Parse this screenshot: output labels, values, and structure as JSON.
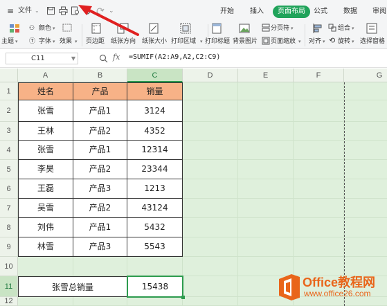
{
  "menubar": {
    "file_label": "文件",
    "tabs": [
      {
        "label": "开始",
        "active": false
      },
      {
        "label": "插入",
        "active": false
      },
      {
        "label": "页面布局",
        "active": true
      },
      {
        "label": "公式",
        "active": false
      },
      {
        "label": "数据",
        "active": false
      },
      {
        "label": "审阅",
        "active": false
      }
    ]
  },
  "ribbon": {
    "theme": "主题",
    "colors": "颜色",
    "fonts": "字体",
    "effects": "效果",
    "margins": "页边距",
    "orientation": "纸张方向",
    "size": "纸张大小",
    "print_area": "打印区域",
    "print_titles": "打印标题",
    "background": "背景图片",
    "page_break": "分页符",
    "page_zoom": "页面缩放",
    "align": "对齐",
    "group": "组合",
    "rotate": "旋转",
    "selection_pane": "选择窗格"
  },
  "formula_bar": {
    "name_box": "C11",
    "fx": "fx",
    "formula": "=SUMIF(A2:A9,A2,C2:C9)"
  },
  "grid": {
    "columns": [
      "A",
      "B",
      "C",
      "D",
      "E",
      "F",
      "G"
    ],
    "rows": [
      "1",
      "2",
      "3",
      "4",
      "5",
      "6",
      "7",
      "8",
      "9",
      "10",
      "11",
      "12"
    ],
    "header": [
      "姓名",
      "产品",
      "销量"
    ],
    "data": [
      [
        "张雪",
        "产品1",
        "3124"
      ],
      [
        "王林",
        "产品2",
        "4352"
      ],
      [
        "张雪",
        "产品1",
        "12314"
      ],
      [
        "李昊",
        "产品2",
        "23344"
      ],
      [
        "王磊",
        "产品3",
        "1213"
      ],
      [
        "吴雪",
        "产品2",
        "43124"
      ],
      [
        "刘伟",
        "产品1",
        "5432"
      ],
      [
        "林雪",
        "产品3",
        "5543"
      ]
    ],
    "summary_label": "张雪总销量",
    "summary_value": "15438",
    "selected_cell": "C11"
  },
  "watermark": {
    "brand": "Office教程网",
    "url": "www.office26.com"
  },
  "colors": {
    "accent": "#20a35a",
    "header_fill": "#f7b287",
    "sheet_bg": "#dff0dc",
    "annotation": "#e02020"
  }
}
